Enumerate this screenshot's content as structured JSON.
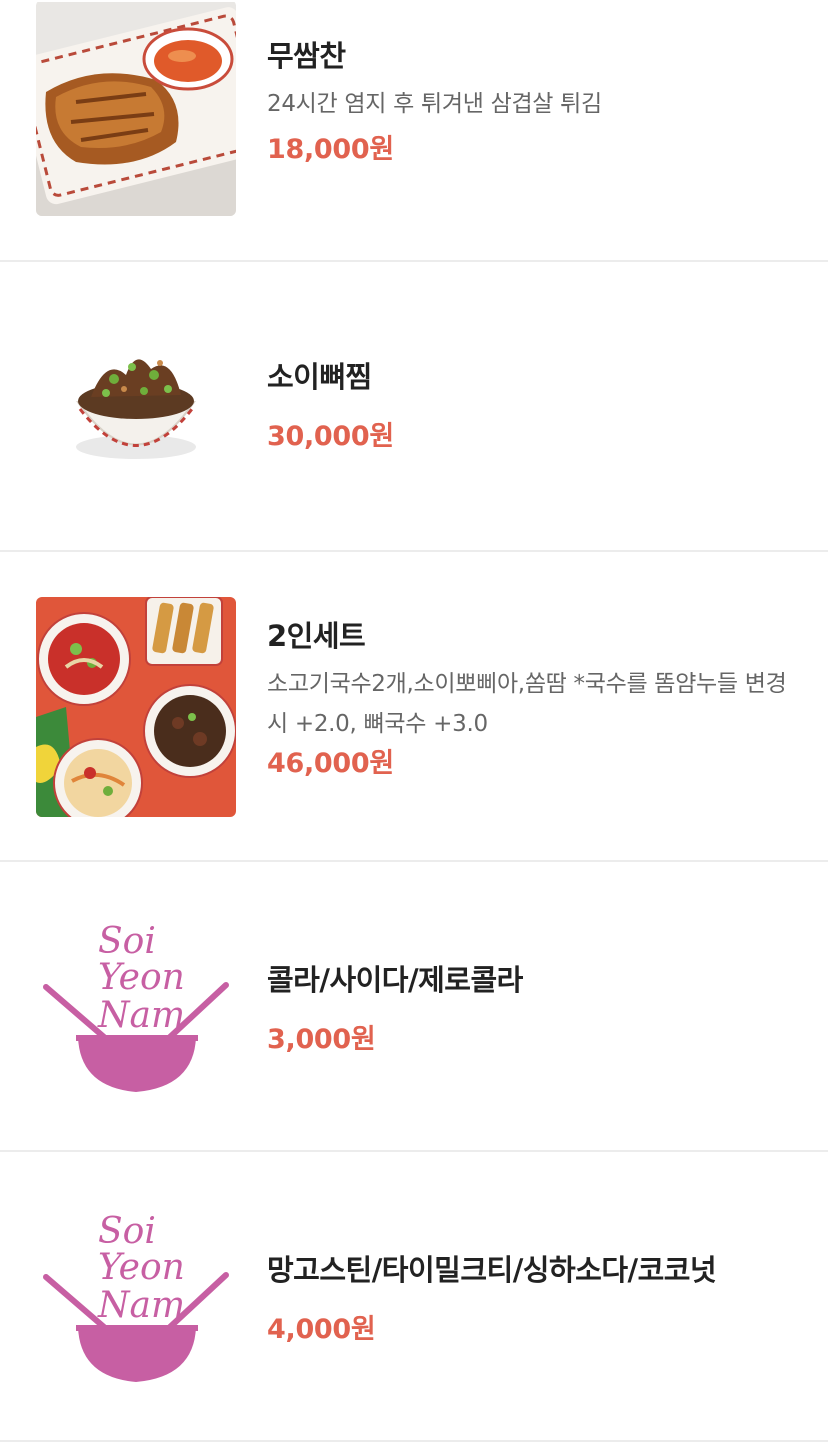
{
  "colors": {
    "price": "#e1624f",
    "name": "#222222",
    "desc": "#666666",
    "logo": "#c75fa3",
    "divider": "#ececec"
  },
  "menu": {
    "items": [
      {
        "name": "무쌈찬",
        "desc": "24시간 염지 후 튀겨낸 삼겹살 튀김",
        "price": "18,000원",
        "image": "fried-pork-belly-photo"
      },
      {
        "name": "소이뼈찜",
        "desc": "",
        "price": "30,000원",
        "image": "braised-beef-rib-bowl-photo"
      },
      {
        "name": "2인세트",
        "desc": "소고기국수2개,소이뽀삐아,쏨땀 *국수를 똠얌누들 변경시 +2.0, 뼈국수 +3.0",
        "price": "46,000원",
        "image": "set-meal-photo"
      },
      {
        "name": "콜라/사이다/제로콜라",
        "desc": "",
        "price": "3,000원",
        "image": "soi-yeon-nam-logo"
      },
      {
        "name": "망고스틴/타이밀크티/싱하소다/코코넛",
        "desc": "",
        "price": "4,000원",
        "image": "soi-yeon-nam-logo"
      }
    ],
    "logo_text": [
      "Soi",
      "Yeon",
      "Nam"
    ]
  }
}
